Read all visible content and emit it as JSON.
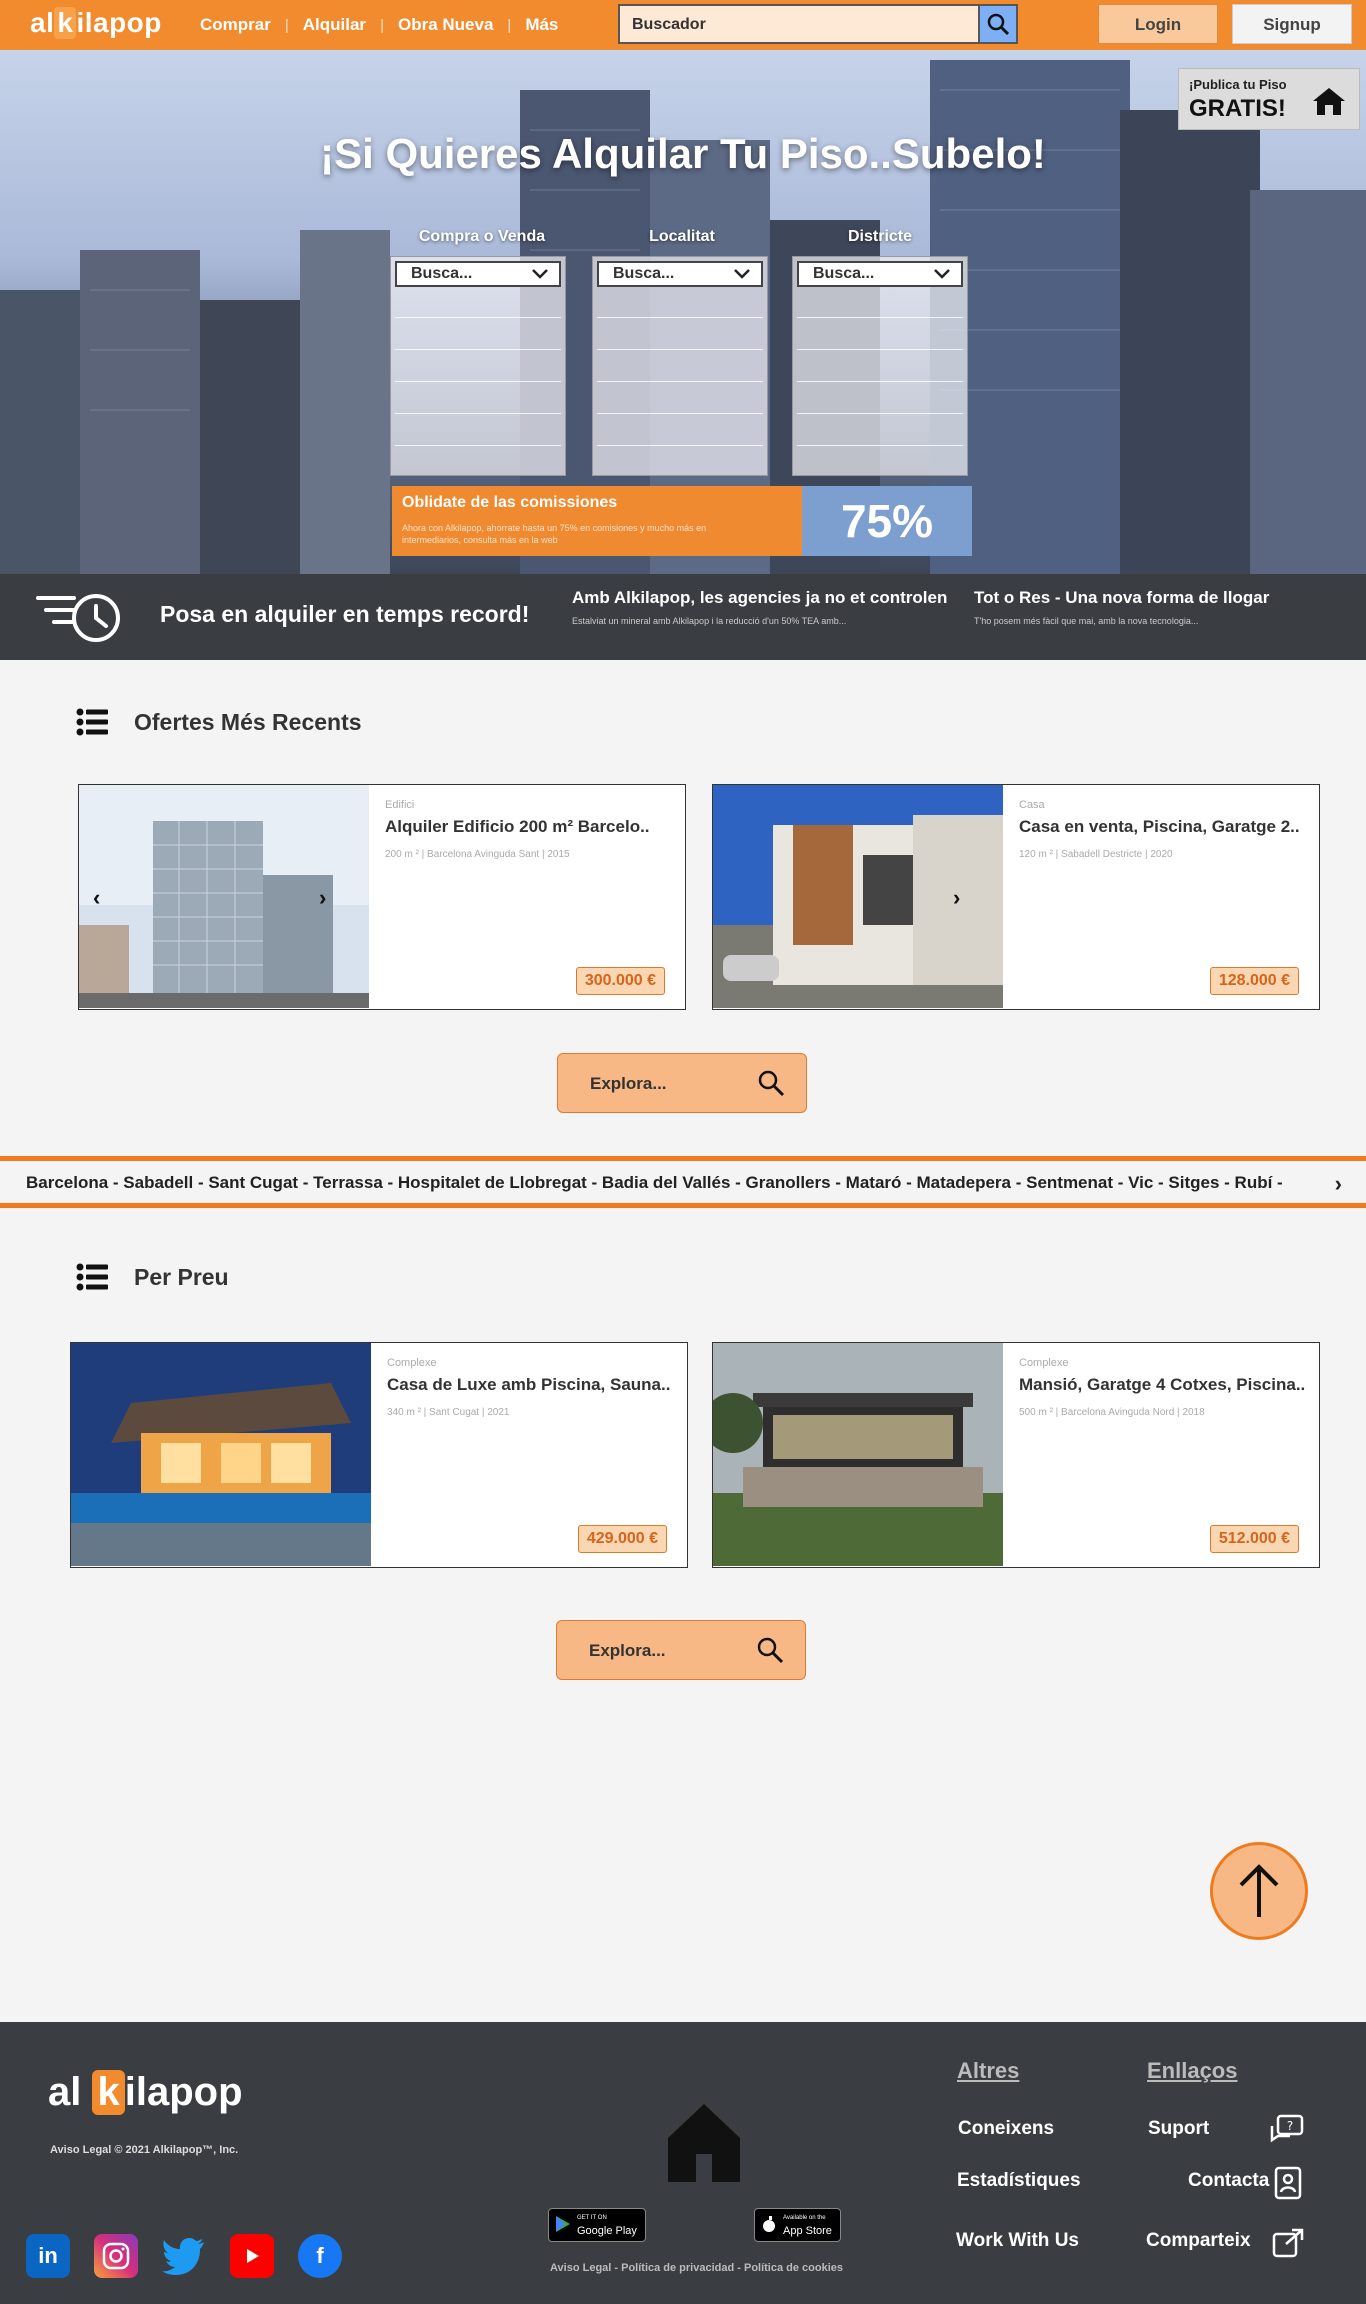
{
  "header": {
    "logo": "alkilapop",
    "nav": [
      "Comprar",
      "Alquilar",
      "Obra Nueva",
      "Más"
    ],
    "search_placeholder": "Buscador",
    "login": "Login",
    "signup": "Signup",
    "brand_color": "#f28a2e"
  },
  "hero": {
    "title": "¡Si Quieres Alquilar Tu Piso..Subelo!",
    "publica_line1": "¡Publica tu Piso",
    "publica_line2": "GRATIS!",
    "filters": [
      {
        "label": "Compra o Venda",
        "value": "Busca..."
      },
      {
        "label": "Localitat",
        "value": "Busca..."
      },
      {
        "label": "Districte",
        "value": "Busca..."
      }
    ],
    "promo_title": "Oblidate de las comissiones",
    "promo_text": "Ahora con Alkilapop, ahorrate hasta un 75% en comisiones y mucho más en intermediarios, consulta más en la web",
    "promo_percent": "75%"
  },
  "strip": {
    "main": "Posa en alquiler en temps record!",
    "col2_title": "Amb Alkilapop, les agencies ja no et controlen",
    "col2_sub": "Estalviat un mineral amb Alkilapop i la reducció d'un 50% TEA amb...",
    "col3_title": "Tot o Res - Una nova forma de llogar",
    "col3_sub": "T'ho posem més fàcil que mai, amb la nova tecnologia..."
  },
  "recent": {
    "title": "Ofertes Més Recents",
    "cards": [
      {
        "category": "Edifici",
        "name": "Alquiler Edificio 200 m² Barcelo..",
        "meta": "200 m ² | Barcelona Avinguda Sant | 2015",
        "price": "300.000 €"
      },
      {
        "category": "Casa",
        "name": "Casa en venta, Piscina, Garatge 2..",
        "meta": "120 m ² | Sabadell Destricte | 2020",
        "price": "128.000 €"
      }
    ],
    "explore": "Explora..."
  },
  "cities": {
    "text": "Barcelona - Sabadell - Sant Cugat - Terrassa - Hospitalet de Llobregat - Badia del Vallés - Granollers - Mataró - Matadepera - Sentmenat - Vic - Sitges - Rubí -"
  },
  "price": {
    "title": "Per Preu",
    "cards": [
      {
        "category": "Complexe",
        "name": "Casa de Luxe amb Piscina, Sauna..",
        "meta": "340 m ² | Sant Cugat | 2021",
        "price": "429.000 €"
      },
      {
        "category": "Complexe",
        "name": "Mansió, Garatge 4 Cotxes, Piscina..",
        "meta": "500 m ² | Barcelona Avinguda Nord | 2018",
        "price": "512.000 €"
      }
    ],
    "explore": "Explora..."
  },
  "footer": {
    "logo": "alkilapop",
    "copyright": "Aviso Legal © 2021 Alkilapop™, Inc.",
    "google_play_small": "GET IT ON",
    "google_play": "Google Play",
    "app_store_small": "Available on the",
    "app_store": "App Store",
    "legal_links": "Aviso Legal - Política de privacidad - Política de cookies",
    "col1_title": "Altres",
    "col1_items": [
      "Coneixens",
      "Estadístiques",
      "Work With Us"
    ],
    "col2_title": "Enllaços",
    "col2_items": [
      "Suport",
      "Contacta",
      "Comparteix"
    ]
  }
}
